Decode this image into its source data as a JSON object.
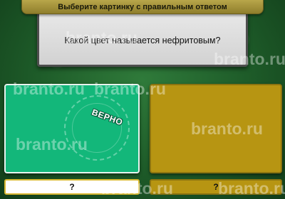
{
  "header": {
    "instruction": "Выберите картинку с правильным ответом"
  },
  "question": {
    "text": "Какой цвет называется нефритовым?"
  },
  "answers": [
    {
      "color": "#13b77a",
      "stamp_label": "ВЕРНО",
      "box_label": "?"
    },
    {
      "color": "#b79512",
      "box_label": "?"
    }
  ],
  "watermark": {
    "text": "branto.ru"
  }
}
